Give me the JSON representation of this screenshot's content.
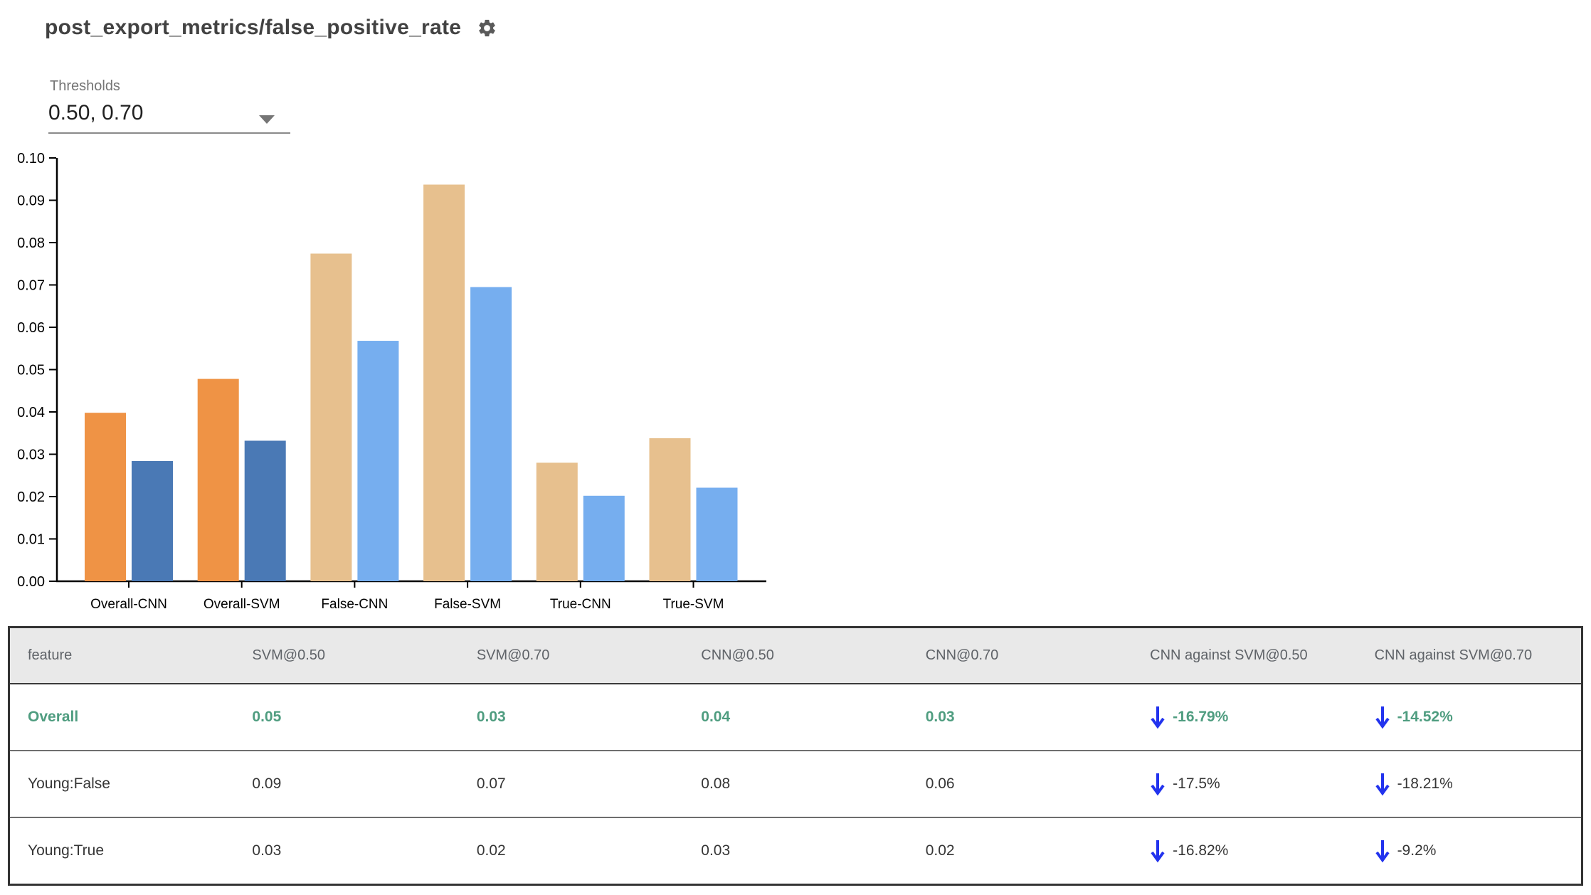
{
  "header": {
    "title": "post_export_metrics/false_positive_rate",
    "settings_icon": "gear-icon"
  },
  "thresholds": {
    "label": "Thresholds",
    "value": "0.50, 0.70"
  },
  "colors": {
    "accent_green": "#4f9d80",
    "arrow_blue": "#2233ee",
    "overall_050_bar": "#ef9345",
    "overall_070_bar": "#4a79b5",
    "slice_050_bar": "#e7c08e",
    "slice_070_bar": "#76aeef",
    "header_bg": "#e9e9e9",
    "header_text": "#5f6368",
    "body_text": "#363636",
    "title_text": "#424242"
  },
  "chart_data": {
    "type": "bar",
    "title": "",
    "xlabel": "",
    "ylabel": "",
    "categories": [
      "Overall-CNN",
      "Overall-SVM",
      "False-CNN",
      "False-SVM",
      "True-CNN",
      "True-SVM"
    ],
    "series": [
      {
        "name": "threshold 0.50",
        "values": [
          0.0398,
          0.0478,
          0.0774,
          0.0937,
          0.028,
          0.0338
        ]
      },
      {
        "name": "threshold 0.70",
        "values": [
          0.0284,
          0.0332,
          0.0568,
          0.0695,
          0.0202,
          0.0221
        ]
      }
    ],
    "colors": [
      [
        "#ef9345",
        "#4a79b5"
      ],
      [
        "#ef9345",
        "#4a79b5"
      ],
      [
        "#e7c08e",
        "#76aeef"
      ],
      [
        "#e7c08e",
        "#76aeef"
      ],
      [
        "#e7c08e",
        "#76aeef"
      ],
      [
        "#e7c08e",
        "#76aeef"
      ]
    ],
    "ylim": [
      0,
      0.1
    ],
    "ytick_step": 0.01,
    "ytick_format": "0.00",
    "grid": "off",
    "legend": "none"
  },
  "table": {
    "columns": [
      "feature",
      "SVM@0.50",
      "SVM@0.70",
      "CNN@0.50",
      "CNN@0.70",
      "CNN against SVM@0.50",
      "CNN against SVM@0.70"
    ],
    "rows": [
      {
        "feature": "Overall",
        "svm_050": "0.05",
        "svm_070": "0.03",
        "cnn_050": "0.04",
        "cnn_070": "0.03",
        "delta_050": "-16.79%",
        "delta_070": "-14.52%",
        "delta_direction": "down",
        "highlight": true
      },
      {
        "feature": "Young:False",
        "svm_050": "0.09",
        "svm_070": "0.07",
        "cnn_050": "0.08",
        "cnn_070": "0.06",
        "delta_050": "-17.5%",
        "delta_070": "-18.21%",
        "delta_direction": "down",
        "highlight": false
      },
      {
        "feature": "Young:True",
        "svm_050": "0.03",
        "svm_070": "0.02",
        "cnn_050": "0.03",
        "cnn_070": "0.02",
        "delta_050": "-16.82%",
        "delta_070": "-9.2%",
        "delta_direction": "down",
        "highlight": false
      }
    ]
  }
}
